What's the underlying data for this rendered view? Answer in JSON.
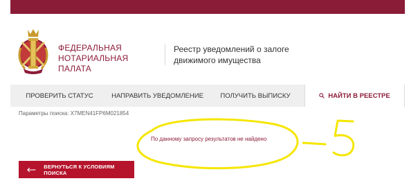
{
  "colors": {
    "brand": "#8b1c38",
    "button": "#b5142c",
    "annotation": "#f5e600"
  },
  "header": {
    "org_line1": "Федеральная",
    "org_line2": "нотариальная палата",
    "registry_line1": "Реестр уведомлений о залоге",
    "registry_line2": "движимого имущества",
    "logo_icon": "notary-emblem-icon"
  },
  "tabs": [
    {
      "label": "Проверить статус",
      "active": false
    },
    {
      "label": "Направить уведомление",
      "active": false
    },
    {
      "label": "Получить выписку",
      "active": false
    },
    {
      "label": "Найти в реестре",
      "active": true,
      "icon": "search-icon"
    }
  ],
  "search": {
    "params_label": "Параметры поиска:",
    "params_value": "X7MEN41FP6M021854",
    "result_message": "По данному запросу результатов не найдено"
  },
  "back_button": {
    "label": "Вернуться к условиям поиска",
    "icon": "arrow-left-icon"
  },
  "annotation": {
    "text": "–5"
  }
}
